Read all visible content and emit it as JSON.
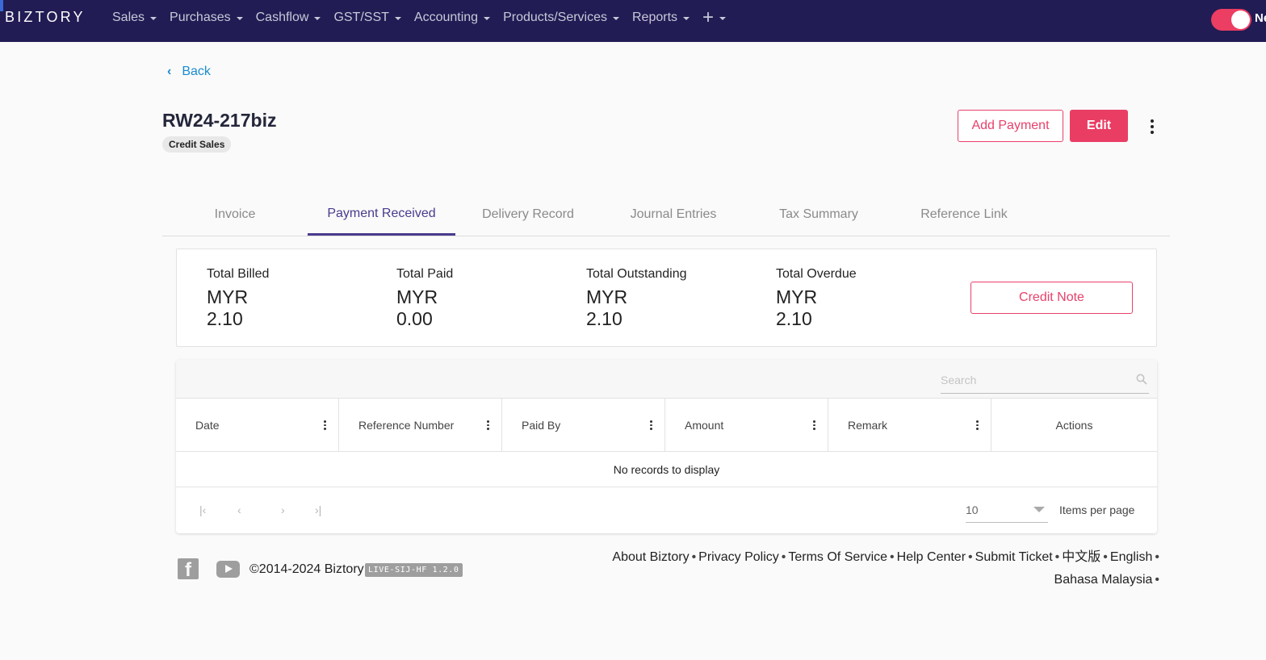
{
  "brand": {
    "logo": "BIZTORY"
  },
  "nav": {
    "items": [
      {
        "label": "Sales"
      },
      {
        "label": "Purchases"
      },
      {
        "label": "Cashflow"
      },
      {
        "label": "GST/SST"
      },
      {
        "label": "Accounting"
      },
      {
        "label": "Products/Services"
      },
      {
        "label": "Reports"
      }
    ],
    "plus": "+",
    "toggle_label": "Ne",
    "toggle_on": true
  },
  "back_label": "Back",
  "document": {
    "number": "RW24-217biz",
    "type_chip": "Credit Sales"
  },
  "actions": {
    "add_payment": "Add Payment",
    "edit": "Edit"
  },
  "tabs": [
    {
      "label": "Invoice",
      "active": false
    },
    {
      "label": "Payment Received",
      "active": true
    },
    {
      "label": "Delivery Record",
      "active": false
    },
    {
      "label": "Journal Entries",
      "active": false
    },
    {
      "label": "Tax Summary",
      "active": false
    },
    {
      "label": "Reference Link",
      "active": false
    }
  ],
  "summary": {
    "billed": {
      "label": "Total Billed",
      "currency": "MYR",
      "value": "2.10"
    },
    "paid": {
      "label": "Total Paid",
      "currency": "MYR",
      "value": "0.00"
    },
    "outstanding": {
      "label": "Total Outstanding",
      "currency": "MYR",
      "value": "2.10"
    },
    "overdue": {
      "label": "Total Overdue",
      "currency": "MYR",
      "value": "2.10"
    },
    "credit_note": "Credit Note"
  },
  "grid": {
    "search_placeholder": "Search",
    "columns": [
      "Date",
      "Reference Number",
      "Paid By",
      "Amount",
      "Remark",
      "Actions"
    ],
    "empty_message": "No records to display",
    "page_size": "10",
    "items_per_page": "Items per page"
  },
  "footer": {
    "copyright": "©2014-2024 Biztory",
    "version": "LIVE-SIJ-HF 1.2.0",
    "links": [
      "About Biztory",
      "Privacy Policy",
      "Terms Of Service",
      "Help Center",
      "Submit Ticket",
      "中文版",
      "English",
      "Bahasa Malaysia"
    ],
    "separator": "•"
  },
  "colors": {
    "nav_bg": "#211c54",
    "accent": "#ea3d64",
    "tab_active": "#4b3a8f",
    "link": "#1a8ccf"
  }
}
